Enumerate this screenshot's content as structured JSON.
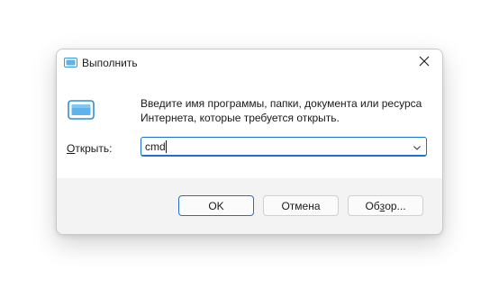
{
  "window": {
    "title": "Выполнить",
    "icon": "run-dialog-icon",
    "close_icon": "close-icon"
  },
  "content": {
    "description_line1": "Введите имя программы, папки, документа или ресурса",
    "description_line2": "Интернета, которые требуется открыть.",
    "app_icon": "run-dialog-icon"
  },
  "open_field": {
    "label_accel": "О",
    "label_rest": "ткрыть:",
    "value": "cmd",
    "dropdown_icon": "chevron-down-icon"
  },
  "buttons": {
    "ok": "OK",
    "cancel": "Отмена",
    "browse_prefix": "Об",
    "browse_accel": "з",
    "browse_suffix": "ор..."
  },
  "colors": {
    "accent": "#1f6fcf",
    "footer_bg": "#f3f3f3",
    "icon_blue": "#3a9ad9"
  }
}
